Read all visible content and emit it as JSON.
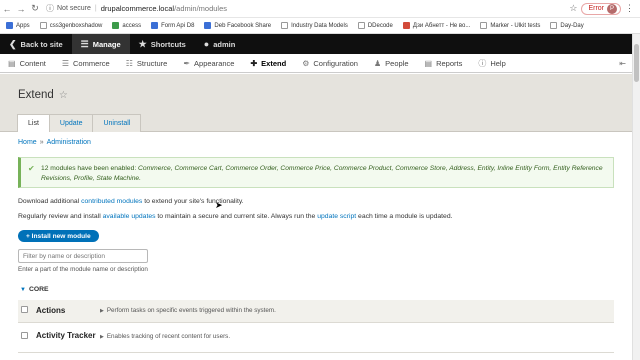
{
  "browser": {
    "security": "Not secure",
    "url_host": "drupalcommerce.local",
    "url_path": "/admin/modules",
    "error_label": "Error",
    "avatar_letter": "P",
    "bookmarks": [
      {
        "label": "Apps",
        "icon": "apps-icon"
      },
      {
        "label": "css3genboxshadow",
        "icon": "doc-icon"
      },
      {
        "label": "access",
        "icon": "doc-icon"
      },
      {
        "label": "Form Api D8",
        "icon": "doc-icon"
      },
      {
        "label": "Deb Facebook Share",
        "icon": "facebook-icon"
      },
      {
        "label": "Industry Data Models",
        "icon": "doc-icon"
      },
      {
        "label": "DDecode",
        "icon": "doc-icon"
      },
      {
        "label": "Дзи Абнетт - Не во...",
        "icon": "book-icon"
      },
      {
        "label": "Marker - Ulkit tests",
        "icon": "doc-icon"
      },
      {
        "label": "Day-Day",
        "icon": "doc-icon"
      }
    ]
  },
  "toolbar": {
    "back": "Back to site",
    "manage": "Manage",
    "shortcuts": "Shortcuts",
    "user": "admin"
  },
  "tray": [
    {
      "label": "Content",
      "icon": "content-icon"
    },
    {
      "label": "Commerce",
      "icon": "cart-icon"
    },
    {
      "label": "Structure",
      "icon": "structure-icon"
    },
    {
      "label": "Appearance",
      "icon": "brush-icon"
    },
    {
      "label": "Extend",
      "icon": "puzzle-icon",
      "active": true
    },
    {
      "label": "Configuration",
      "icon": "wrench-icon"
    },
    {
      "label": "People",
      "icon": "people-icon"
    },
    {
      "label": "Reports",
      "icon": "reports-icon"
    },
    {
      "label": "Help",
      "icon": "help-icon"
    }
  ],
  "page": {
    "title": "Extend",
    "tabs": [
      "List",
      "Update",
      "Uninstall"
    ],
    "breadcrumb": [
      "Home",
      "Administration"
    ]
  },
  "status": {
    "prefix": "12 modules have been enabled: ",
    "modules": "Commerce, Commerce Cart, Commerce Order, Commerce Price, Commerce Product, Commerce Store, Address, Entity, Inline Entity Form, Entity Reference Revisions, Profile, State Machine."
  },
  "intro": {
    "p1_a": "Download additional ",
    "p1_link": "contributed modules",
    "p1_b": " to extend your site's functionality.",
    "p2_a": "Regularly review and install ",
    "p2_link1": "available updates",
    "p2_b": " to maintain a secure and current site. Always run the ",
    "p2_link2": "update script",
    "p2_c": " each time a module is updated."
  },
  "install_button": "+ Install new module",
  "filter": {
    "placeholder": "Filter by name or description",
    "description": "Enter a part of the module name or description"
  },
  "group": "CORE",
  "modules": [
    {
      "name": "Actions",
      "desc": "Perform tasks on specific events triggered within the system."
    },
    {
      "name": "Activity Tracker",
      "desc": "Enables tracking of recent content for users."
    }
  ]
}
